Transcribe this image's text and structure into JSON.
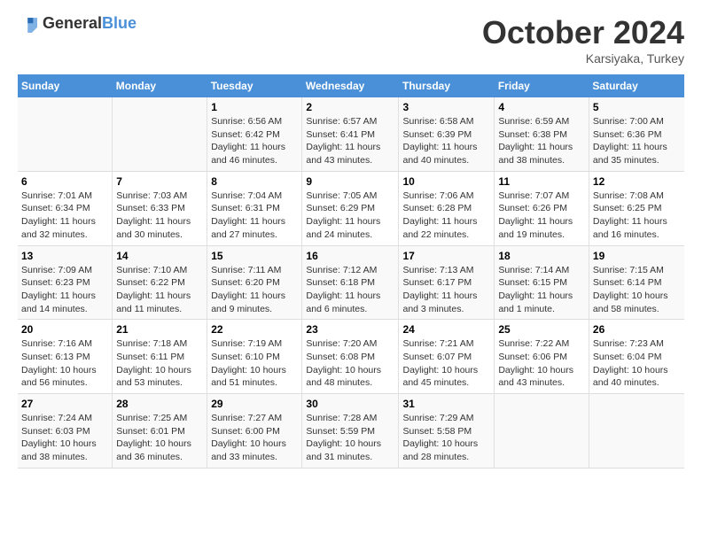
{
  "header": {
    "logo_general": "General",
    "logo_blue": "Blue",
    "month_title": "October 2024",
    "subtitle": "Karsiyaka, Turkey"
  },
  "weekdays": [
    "Sunday",
    "Monday",
    "Tuesday",
    "Wednesday",
    "Thursday",
    "Friday",
    "Saturday"
  ],
  "weeks": [
    [
      {
        "day": "",
        "info": ""
      },
      {
        "day": "",
        "info": ""
      },
      {
        "day": "1",
        "info": "Sunrise: 6:56 AM\nSunset: 6:42 PM\nDaylight: 11 hours and 46 minutes."
      },
      {
        "day": "2",
        "info": "Sunrise: 6:57 AM\nSunset: 6:41 PM\nDaylight: 11 hours and 43 minutes."
      },
      {
        "day": "3",
        "info": "Sunrise: 6:58 AM\nSunset: 6:39 PM\nDaylight: 11 hours and 40 minutes."
      },
      {
        "day": "4",
        "info": "Sunrise: 6:59 AM\nSunset: 6:38 PM\nDaylight: 11 hours and 38 minutes."
      },
      {
        "day": "5",
        "info": "Sunrise: 7:00 AM\nSunset: 6:36 PM\nDaylight: 11 hours and 35 minutes."
      }
    ],
    [
      {
        "day": "6",
        "info": "Sunrise: 7:01 AM\nSunset: 6:34 PM\nDaylight: 11 hours and 32 minutes."
      },
      {
        "day": "7",
        "info": "Sunrise: 7:03 AM\nSunset: 6:33 PM\nDaylight: 11 hours and 30 minutes."
      },
      {
        "day": "8",
        "info": "Sunrise: 7:04 AM\nSunset: 6:31 PM\nDaylight: 11 hours and 27 minutes."
      },
      {
        "day": "9",
        "info": "Sunrise: 7:05 AM\nSunset: 6:29 PM\nDaylight: 11 hours and 24 minutes."
      },
      {
        "day": "10",
        "info": "Sunrise: 7:06 AM\nSunset: 6:28 PM\nDaylight: 11 hours and 22 minutes."
      },
      {
        "day": "11",
        "info": "Sunrise: 7:07 AM\nSunset: 6:26 PM\nDaylight: 11 hours and 19 minutes."
      },
      {
        "day": "12",
        "info": "Sunrise: 7:08 AM\nSunset: 6:25 PM\nDaylight: 11 hours and 16 minutes."
      }
    ],
    [
      {
        "day": "13",
        "info": "Sunrise: 7:09 AM\nSunset: 6:23 PM\nDaylight: 11 hours and 14 minutes."
      },
      {
        "day": "14",
        "info": "Sunrise: 7:10 AM\nSunset: 6:22 PM\nDaylight: 11 hours and 11 minutes."
      },
      {
        "day": "15",
        "info": "Sunrise: 7:11 AM\nSunset: 6:20 PM\nDaylight: 11 hours and 9 minutes."
      },
      {
        "day": "16",
        "info": "Sunrise: 7:12 AM\nSunset: 6:18 PM\nDaylight: 11 hours and 6 minutes."
      },
      {
        "day": "17",
        "info": "Sunrise: 7:13 AM\nSunset: 6:17 PM\nDaylight: 11 hours and 3 minutes."
      },
      {
        "day": "18",
        "info": "Sunrise: 7:14 AM\nSunset: 6:15 PM\nDaylight: 11 hours and 1 minute."
      },
      {
        "day": "19",
        "info": "Sunrise: 7:15 AM\nSunset: 6:14 PM\nDaylight: 10 hours and 58 minutes."
      }
    ],
    [
      {
        "day": "20",
        "info": "Sunrise: 7:16 AM\nSunset: 6:13 PM\nDaylight: 10 hours and 56 minutes."
      },
      {
        "day": "21",
        "info": "Sunrise: 7:18 AM\nSunset: 6:11 PM\nDaylight: 10 hours and 53 minutes."
      },
      {
        "day": "22",
        "info": "Sunrise: 7:19 AM\nSunset: 6:10 PM\nDaylight: 10 hours and 51 minutes."
      },
      {
        "day": "23",
        "info": "Sunrise: 7:20 AM\nSunset: 6:08 PM\nDaylight: 10 hours and 48 minutes."
      },
      {
        "day": "24",
        "info": "Sunrise: 7:21 AM\nSunset: 6:07 PM\nDaylight: 10 hours and 45 minutes."
      },
      {
        "day": "25",
        "info": "Sunrise: 7:22 AM\nSunset: 6:06 PM\nDaylight: 10 hours and 43 minutes."
      },
      {
        "day": "26",
        "info": "Sunrise: 7:23 AM\nSunset: 6:04 PM\nDaylight: 10 hours and 40 minutes."
      }
    ],
    [
      {
        "day": "27",
        "info": "Sunrise: 7:24 AM\nSunset: 6:03 PM\nDaylight: 10 hours and 38 minutes."
      },
      {
        "day": "28",
        "info": "Sunrise: 7:25 AM\nSunset: 6:01 PM\nDaylight: 10 hours and 36 minutes."
      },
      {
        "day": "29",
        "info": "Sunrise: 7:27 AM\nSunset: 6:00 PM\nDaylight: 10 hours and 33 minutes."
      },
      {
        "day": "30",
        "info": "Sunrise: 7:28 AM\nSunset: 5:59 PM\nDaylight: 10 hours and 31 minutes."
      },
      {
        "day": "31",
        "info": "Sunrise: 7:29 AM\nSunset: 5:58 PM\nDaylight: 10 hours and 28 minutes."
      },
      {
        "day": "",
        "info": ""
      },
      {
        "day": "",
        "info": ""
      }
    ]
  ]
}
